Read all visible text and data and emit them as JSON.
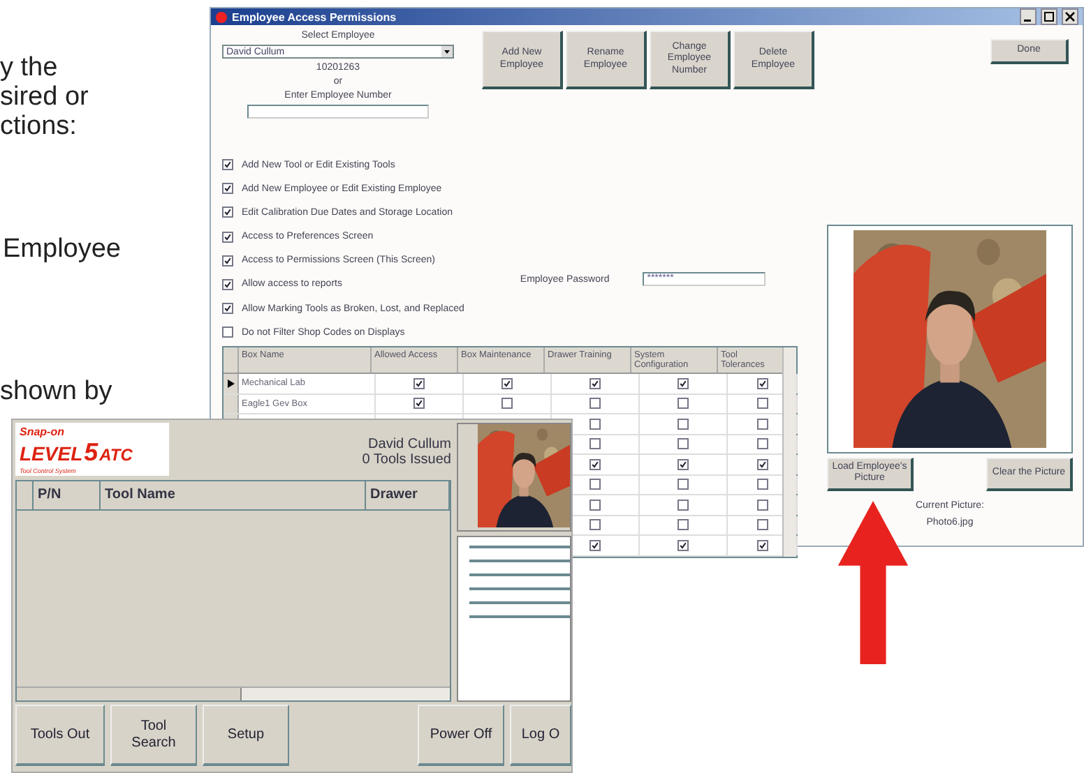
{
  "page_text": [
    "y the",
    "sired or",
    "ctions:",
    "Employee",
    "shown by"
  ],
  "permissions_window": {
    "title": "Employee Access Permissions",
    "select_label": "Select Employee",
    "employee": "David Cullum",
    "employee_number": "10201263",
    "or_label": "or",
    "enter_label": "Enter Employee Number",
    "buttons": [
      "Add New Employee",
      "Rename Employee",
      "Change Employee Number",
      "Delete Employee"
    ],
    "done": "Done",
    "checkboxes": [
      {
        "label": "Add New Tool or Edit Existing Tools",
        "checked": true
      },
      {
        "label": "Add New Employee or Edit Existing Employee",
        "checked": true
      },
      {
        "label": "Edit Calibration Due Dates and Storage Location",
        "checked": true
      },
      {
        "label": "Access to Preferences Screen",
        "checked": true
      },
      {
        "label": "Access to Permissions Screen (This Screen)",
        "checked": true
      },
      {
        "label": "Allow access to reports",
        "checked": true
      },
      {
        "label": "Allow Marking Tools as Broken, Lost, and Replaced",
        "checked": true
      },
      {
        "label": "Do not Filter Shop Codes on Displays",
        "checked": false
      }
    ],
    "password_label": "Employee Password",
    "password_value": "*******",
    "table": {
      "columns": [
        "Box Name",
        "Allowed Access",
        "Box Maintenance",
        "Drawer Training",
        "System Configuration",
        "Tool Tolerances"
      ],
      "rows": [
        {
          "name": "Mechanical Lab",
          "selected": true,
          "cells": [
            true,
            true,
            true,
            true,
            true
          ]
        },
        {
          "name": "Eagle1 Gev Box",
          "selected": false,
          "cells": [
            true,
            false,
            false,
            false,
            false
          ]
        },
        {
          "selected": false,
          "cells": [
            null,
            null,
            false,
            false,
            false
          ]
        },
        {
          "selected": false,
          "cells": [
            null,
            null,
            false,
            false,
            false
          ]
        },
        {
          "selected": false,
          "cells": [
            null,
            null,
            true,
            true,
            true
          ]
        },
        {
          "selected": false,
          "cells": [
            null,
            null,
            false,
            false,
            false
          ]
        },
        {
          "selected": false,
          "cells": [
            null,
            null,
            false,
            false,
            false
          ]
        },
        {
          "selected": false,
          "cells": [
            null,
            null,
            false,
            false,
            false
          ]
        },
        {
          "selected": false,
          "cells": [
            null,
            null,
            true,
            true,
            true
          ]
        }
      ]
    },
    "load_button": "Load Employee's Picture",
    "clear_button": "Clear the Picture",
    "current_label": "Current Picture:",
    "current_file": "Photo6.jpg"
  },
  "level5_window": {
    "logo": {
      "brand": "Snap-on",
      "level": "LEVEL",
      "five": "5",
      "atc": "ATC",
      "tagline": "Tool Control System"
    },
    "user_name": "David Cullum",
    "tools_issued": "0 Tools Issued",
    "columns": [
      "P/N",
      "Tool Name",
      "Drawer"
    ],
    "buttons": [
      "Tools Out",
      "Tool Search",
      "Setup",
      "Power Off",
      "Log O"
    ]
  }
}
